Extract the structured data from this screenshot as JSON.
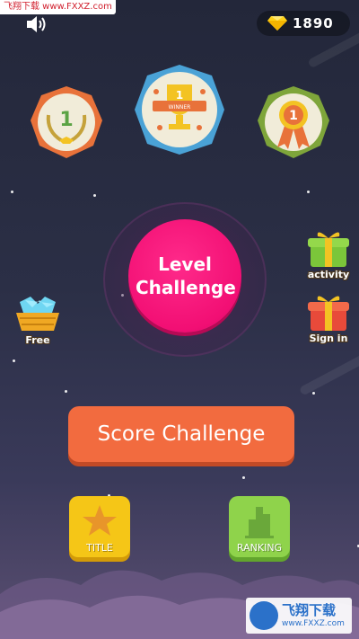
{
  "watermark_top": "飞翔下载 www.FXXZ.com",
  "gems": {
    "count": "1890",
    "icon": "diamond-icon",
    "color": "#ffd21a"
  },
  "sound": {
    "icon": "speaker-icon"
  },
  "medals": [
    {
      "icon": "laurel-medal-icon",
      "number": "1"
    },
    {
      "icon": "trophy-medal-icon",
      "number": "1",
      "ribbon": "WINNER"
    },
    {
      "icon": "rosette-medal-icon",
      "number": "1"
    }
  ],
  "level_challenge": {
    "label": "Level Challenge",
    "color": "#f20f74"
  },
  "free": {
    "label": "Free",
    "icon": "gem-basket-icon"
  },
  "activity": {
    "label": "activity",
    "icon": "gift-box-icon"
  },
  "sign_in": {
    "label": "Sign in",
    "icon": "gift-box-icon"
  },
  "score_challenge": {
    "label": "Score Challenge",
    "color": "#f26b3f"
  },
  "title_button": {
    "label": "TITLE",
    "icon": "star-icon"
  },
  "ranking_button": {
    "label": "RANKING",
    "icon": "bar-chart-icon"
  },
  "watermark_br": {
    "name": "飞翔下载",
    "url": "www.FXXZ.com"
  }
}
